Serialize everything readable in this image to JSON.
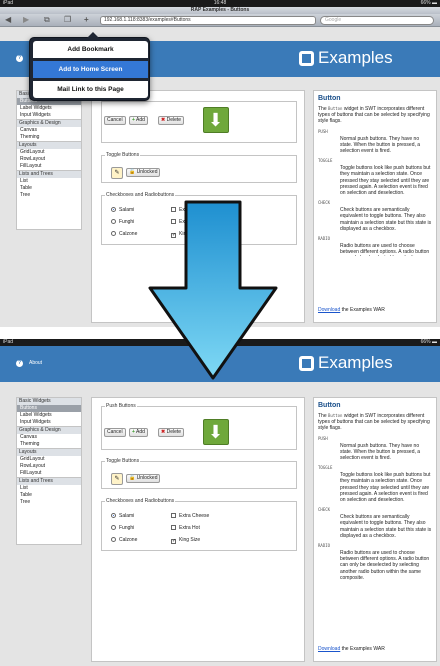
{
  "status": {
    "carrier": "iPad",
    "time": "16:48",
    "battery": "66% ▬",
    "time2": "16:48"
  },
  "browser": {
    "title": "RAP Examples - Buttons",
    "url_top": "192.168.1.118:8383/examples#Buttons",
    "url_bottom": "192.168.1.118:8383/examples#Buttons",
    "search_placeholder": "Google"
  },
  "popover": {
    "items": [
      {
        "label": "Add Bookmark"
      },
      {
        "label": "Add to Home Screen"
      },
      {
        "label": "Mail Link to this Page"
      }
    ]
  },
  "header": {
    "about": "About",
    "logo": "Examples"
  },
  "sidebar": {
    "categories": [
      {
        "label": "Basic Widgets",
        "items": [
          "Buttons",
          "Label Widgets",
          "Input Widgets"
        ]
      },
      {
        "label": "Graphics & Design",
        "items": [
          "Canvas",
          "Theming"
        ]
      },
      {
        "label": "Layouts",
        "items": [
          "GridLayout",
          "RowLayout",
          "FillLayout"
        ]
      },
      {
        "label": "Lists and Trees",
        "items": [
          "List",
          "Table",
          "Tree"
        ]
      }
    ],
    "selected": "Buttons"
  },
  "content": {
    "push": {
      "legend": "Push Buttons",
      "cancel": "Cancel",
      "add": "Add",
      "delete": "Delete"
    },
    "toggle": {
      "legend": "Toggle Buttons",
      "unlocked": "Unlocked"
    },
    "checks": {
      "legend": "Checkboxes and Radiobuttons",
      "radios": [
        "Salami",
        "Funghi",
        "Calzone"
      ],
      "selected_radio": "Salami",
      "checkboxes": [
        "Extra Cheese",
        "Extra Hot",
        "King Size"
      ],
      "checked": [
        "King Size"
      ]
    }
  },
  "doc": {
    "title": "Button",
    "intro_a": "The",
    "intro_code": "Button",
    "intro_b": "widget in SWT incorporates different types of buttons that can be selected by specifying style flags.",
    "entries": [
      {
        "term": "PUSH",
        "def": "Normal push buttons. They have no state. When the button is pressed, a selection event is fired."
      },
      {
        "term": "TOGGLE",
        "def": "Toggle buttons look like push buttons but they maintain a selection state. Once pressed they stay selected until they are pressed again. A selection event is fired on selection and deselection."
      },
      {
        "term": "CHECK",
        "def": "Check buttons are semantically equivalent to toggle buttons. They also maintain a selection state but this state is displayed as a checkbox."
      },
      {
        "term": "RADIO",
        "def": "Radio buttons are used to choose between different options. A radio button can only be deselected by selecting another radio button within the same composite."
      }
    ],
    "download_link": "Download",
    "download_rest": "the Examples WAR"
  },
  "colors": {
    "header": "#3a7ab8",
    "arrow": "#27a9e1",
    "popover_highlight": "#3478d6"
  }
}
